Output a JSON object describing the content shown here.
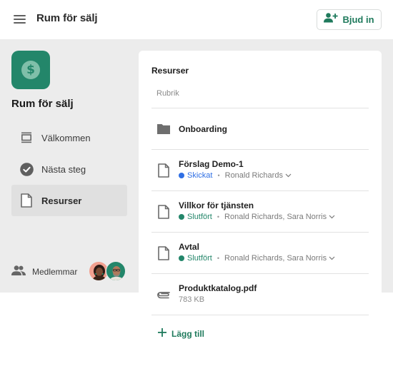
{
  "topbar": {
    "title": "Rum för sälj",
    "invite_label": "Bjud in"
  },
  "colors": {
    "brand": "#23866a",
    "accent_text": "#1f7a5c",
    "status_sent": "#2f6fe4",
    "status_done": "#23866a"
  },
  "sidebar": {
    "room_name": "Rum för sälj",
    "items": [
      {
        "label": "Välkommen",
        "icon": "slides-icon",
        "active": false
      },
      {
        "label": "Nästa steg",
        "icon": "check-circle-icon",
        "active": false
      },
      {
        "label": "Resurser",
        "icon": "document-icon",
        "active": true
      }
    ],
    "members_label": "Medlemmar"
  },
  "main": {
    "title": "Resurser",
    "heading_placeholder": "Rubrik",
    "items": [
      {
        "name": "Onboarding",
        "type": "folder"
      },
      {
        "name": "Förslag Demo-1",
        "type": "document",
        "status": "Skickat",
        "people": "Ronald Richards"
      },
      {
        "name": "Villkor för tjänsten",
        "type": "document",
        "status": "Slutfört",
        "people": "Ronald Richards, Sara Norris"
      },
      {
        "name": "Avtal",
        "type": "document",
        "status": "Slutfört",
        "people": "Ronald Richards, Sara Norris"
      },
      {
        "name": "Produktkatalog.pdf",
        "type": "attachment",
        "size": "783 KB"
      }
    ],
    "separator": "•",
    "add_label": "Lägg till"
  }
}
